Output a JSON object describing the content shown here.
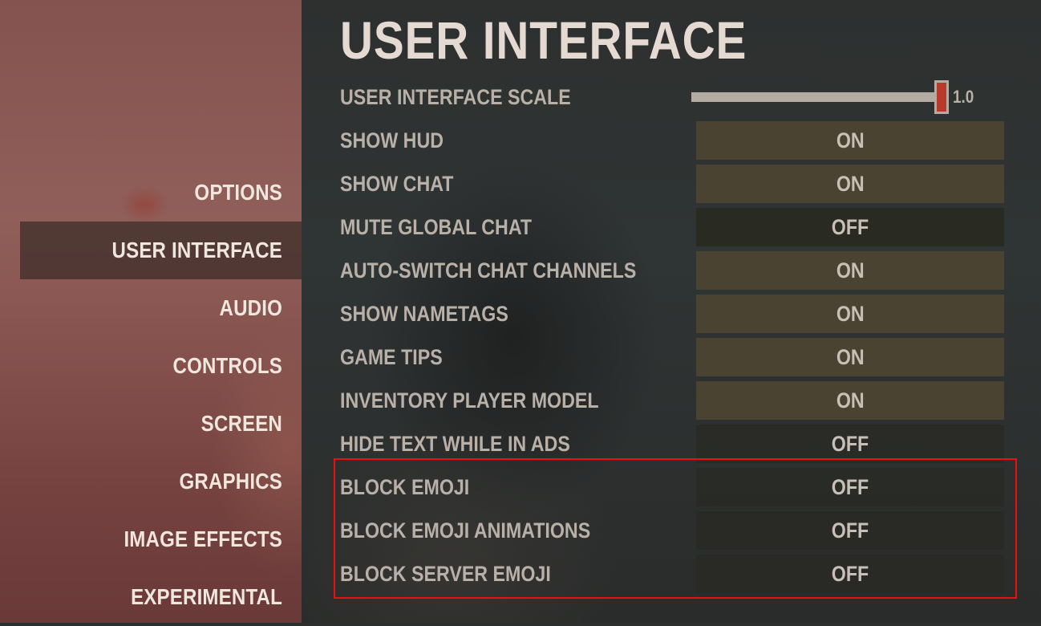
{
  "sidebar": {
    "items": [
      {
        "label": "OPTIONS",
        "active": false
      },
      {
        "label": "USER INTERFACE",
        "active": true
      },
      {
        "label": "AUDIO",
        "active": false
      },
      {
        "label": "CONTROLS",
        "active": false
      },
      {
        "label": "SCREEN",
        "active": false
      },
      {
        "label": "GRAPHICS",
        "active": false
      },
      {
        "label": "IMAGE EFFECTS",
        "active": false
      },
      {
        "label": "EXPERIMENTAL",
        "active": false
      }
    ]
  },
  "main": {
    "title": "USER INTERFACE",
    "scale": {
      "label": "USER INTERFACE SCALE",
      "value": "1.0",
      "fraction": 1.0
    },
    "settings": [
      {
        "label": "SHOW HUD",
        "value": "ON"
      },
      {
        "label": "SHOW CHAT",
        "value": "ON"
      },
      {
        "label": "MUTE GLOBAL CHAT",
        "value": "OFF"
      },
      {
        "label": "AUTO-SWITCH CHAT CHANNELS",
        "value": "ON"
      },
      {
        "label": "SHOW NAMETAGS",
        "value": "ON"
      },
      {
        "label": "GAME TIPS",
        "value": "ON"
      },
      {
        "label": "INVENTORY PLAYER MODEL",
        "value": "ON"
      },
      {
        "label": "HIDE TEXT WHILE IN ADS",
        "value": "OFF"
      },
      {
        "label": "BLOCK EMOJI",
        "value": "OFF"
      },
      {
        "label": "BLOCK EMOJI ANIMATIONS",
        "value": "OFF"
      },
      {
        "label": "BLOCK SERVER EMOJI",
        "value": "OFF"
      }
    ]
  },
  "colors": {
    "highlight": "#e81010",
    "slider_thumb": "#b83a2a",
    "toggle_on": "#4b4332",
    "toggle_off": "#292a22",
    "sidebar": "#8a5652"
  }
}
